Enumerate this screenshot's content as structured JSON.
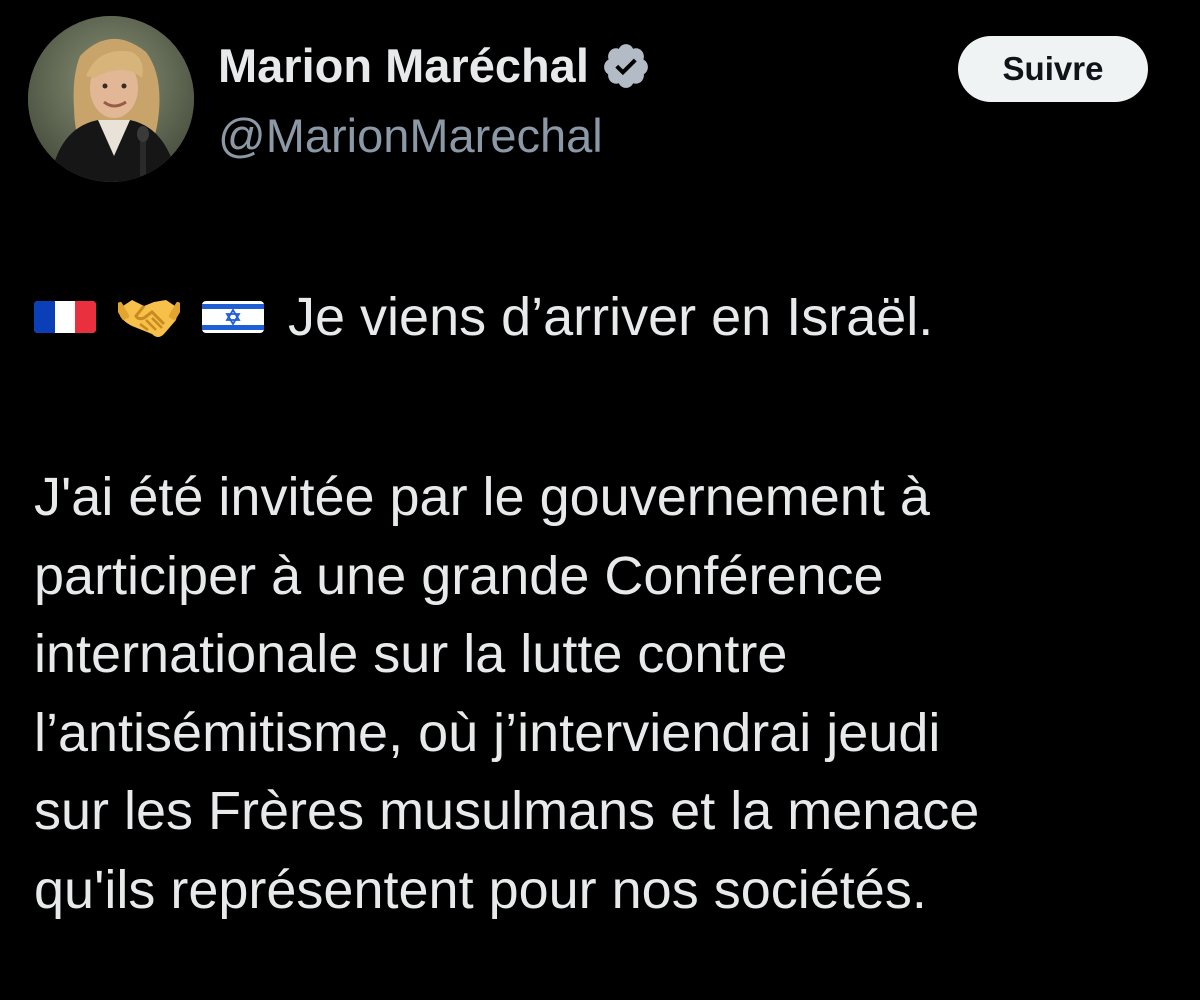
{
  "author": {
    "display_name": "Marion Maréchal",
    "handle": "@MarionMarechal",
    "verified_icon": "verified-badge-icon",
    "verified_color": "#b3bcc6"
  },
  "follow_button": {
    "label": "Suivre"
  },
  "tweet": {
    "emojis": [
      "flag-france",
      "handshake",
      "flag-israel"
    ],
    "first_line": "Je viens d’arriver en Israël.",
    "body_lines": [
      "J'ai été invitée par le gouvernement à",
      "participer à une grande Conférence",
      "internationale sur la lutte contre",
      "l’antisémitisme, où j’interviendrai jeudi",
      "sur les Frères musulmans et la menace",
      "qu'ils représentent pour nos sociétés."
    ]
  },
  "colors": {
    "background": "#000000",
    "text_primary": "#e7e9ea",
    "text_secondary": "#8b98a5",
    "button_bg": "#eff3f4",
    "button_text": "#0f1419"
  }
}
